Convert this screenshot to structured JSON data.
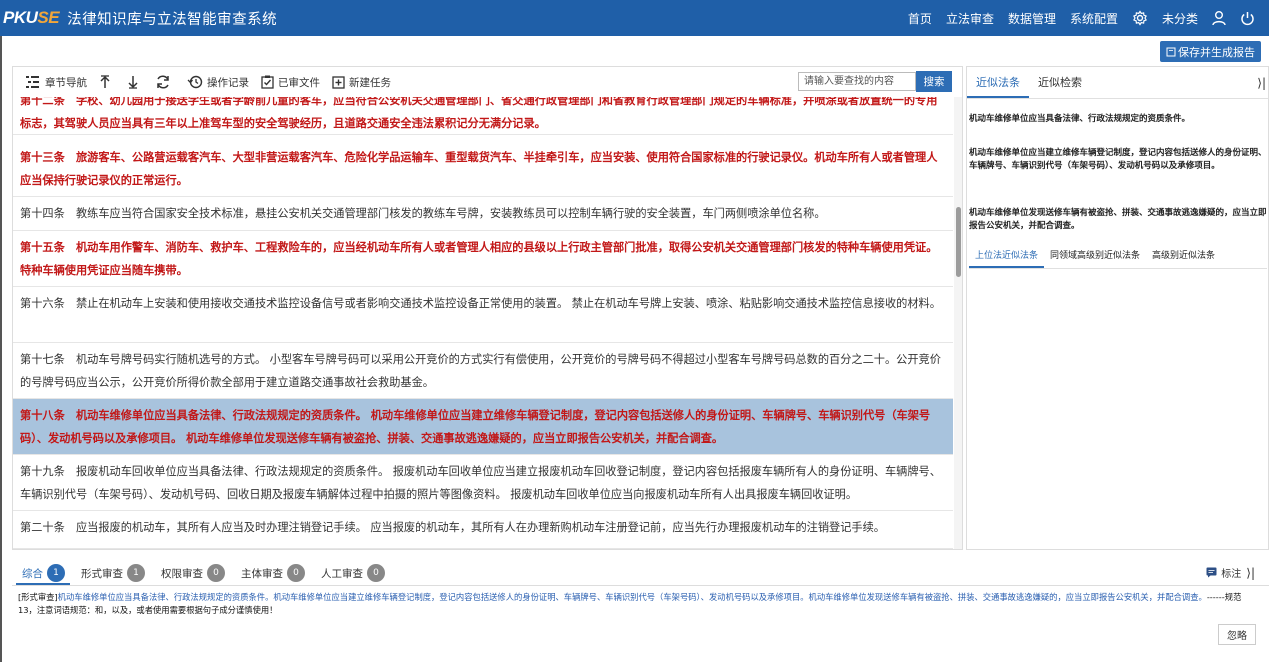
{
  "app": {
    "logo_part1": "PKU",
    "logo_part2": "SE",
    "title": "法律知识库与立法智能审查系统"
  },
  "topnav": {
    "items": [
      "首页",
      "立法审查",
      "数据管理",
      "系统配置"
    ],
    "category": "未分类"
  },
  "save_button": "保存并生成报告",
  "toolbar": {
    "chapter_nav": "章节导航",
    "history": "操作记录",
    "reviewed_files": "已审文件",
    "new_task": "新建任务",
    "search_placeholder": "请输入要查找的内容",
    "search_button": "搜索"
  },
  "articles": [
    {
      "style": "red",
      "text": "第十二条　学校、幼儿园用于接送学生或者学龄前儿童的客车，应当符合公安机关交通管理部门、省交通行政管理部门和省教育行政管理部门规定的车辆标准，并喷涂或者放置统一的专用标志，其驾驶人员应当具有三年以上准驾车型的安全驾驶经历，且道路交通安全违法累积记分无满分记录。"
    },
    {
      "style": "red",
      "text": "第十三条　旅游客车、公路营运载客汽车、大型非营运载客汽车、危险化学品运输车、重型载货汽车、半挂牵引车，应当安装、使用符合国家标准的行驶记录仪。机动车所有人或者管理人应当保持行驶记录仪的正常运行。"
    },
    {
      "style": "dark",
      "text": "第十四条　教练车应当符合国家安全技术标准，悬挂公安机关交通管理部门核发的教练车号牌，安装教练员可以控制车辆行驶的安全装置，车门两侧喷涂单位名称。"
    },
    {
      "style": "red",
      "text": "第十五条　机动车用作警车、消防车、救护车、工程救险车的，应当经机动车所有人或者管理人相应的县级以上行政主管部门批准，取得公安机关交通管理部门核发的特种车辆使用凭证。特种车辆使用凭证应当随车携带。"
    },
    {
      "style": "dark",
      "text": "第十六条　禁止在机动车上安装和使用接收交通技术监控设备信号或者影响交通技术监控设备正常使用的装置。 禁止在机动车号牌上安装、喷涂、粘贴影响交通技术监控信息接收的材料。"
    },
    {
      "style": "dark",
      "text": "第十七条　机动车号牌号码实行随机选号的方式。 小型客车号牌号码可以采用公开竞价的方式实行有偿使用，公开竞价的号牌号码不得超过小型客车号牌号码总数的百分之二十。公开竞价的号牌号码应当公示，公开竞价所得价款全部用于建立道路交通事故社会救助基金。"
    },
    {
      "style": "sel",
      "text": "第十八条　机动车维修单位应当具备法律、行政法规规定的资质条件。 机动车维修单位应当建立维修车辆登记制度，登记内容包括送修人的身份证明、车辆牌号、车辆识别代号（车架号码）、发动机号码以及承修项目。 机动车维修单位发现送修车辆有被盗抢、拼装、交通事故逃逸嫌疑的，应当立即报告公安机关，并配合调查。"
    },
    {
      "style": "dark",
      "text": "第十九条　报废机动车回收单位应当具备法律、行政法规规定的资质条件。 报废机动车回收单位应当建立报废机动车回收登记制度，登记内容包括报废车辆所有人的身份证明、车辆牌号、车辆识别代号（车架号码）、发动机号码、回收日期及报废车辆解体过程中拍摄的照片等图像资料。 报废机动车回收单位应当向报废机动车所有人出具报废车辆回收证明。"
    },
    {
      "style": "dark",
      "text": "第二十条　应当报废的机动车，其所有人应当及时办理注销登记手续。 应当报废的机动车，其所有人在办理新购机动车注册登记前，应当先行办理报废机动车的注销登记手续。"
    }
  ],
  "right_panel": {
    "tabs": [
      "近似法条",
      "近似检索"
    ],
    "close": "⟩|",
    "clauses": [
      "机动车维修单位应当具备法律、行政法规规定的资质条件。",
      "机动车维修单位应当建立维修车辆登记制度，登记内容包括送修人的身份证明、车辆牌号、车辆识别代号（车架号码）、发动机号码以及承修项目。",
      "机动车维修单位发现送修车辆有被盗抢、拼装、交通事故逃逸嫌疑的，应当立即报告公安机关，并配合调查。"
    ],
    "subtabs": [
      "上位法近似法条",
      "同领域高级别近似法条",
      "高级别近似法条"
    ]
  },
  "bottom": {
    "tabs": [
      {
        "label": "综合",
        "count": "1"
      },
      {
        "label": "形式审查",
        "count": "1"
      },
      {
        "label": "权限审查",
        "count": "0"
      },
      {
        "label": "主体审查",
        "count": "0"
      },
      {
        "label": "人工审查",
        "count": "0"
      }
    ],
    "annotate": "标注",
    "review_prefix": "[形式审查]",
    "review_quote": "机动车维修单位应当具备法律、行政法规规定的资质条件。机动车维修单位应当建立维修车辆登记制度，登记内容包括送修人的身份证明、车辆牌号、车辆识别代号（车架号码）、发动机号码以及承修项目。机动车维修单位发现送修车辆有被盗抢、拼装、交通事故逃逸嫌疑的，应当立即报告公安机关，并配合调查。",
    "review_note": "------规范13，注意词语规范：和，以及，或者使用需要根据句子成分谨慎使用！",
    "ignore_button": "忽略"
  },
  "colors": {
    "topbar": "#1f5fa8",
    "accent": "#2d6db5",
    "red_text": "#c21818",
    "selected_row": "#a8c3dd"
  },
  "icons": [
    "chapter-nav-icon",
    "arrow-up-icon",
    "arrow-down-icon",
    "refresh-icon",
    "history-icon",
    "reviewed-files-icon",
    "new-task-icon",
    "settings-icon",
    "user-icon",
    "power-icon",
    "save-icon",
    "comment-icon"
  ]
}
